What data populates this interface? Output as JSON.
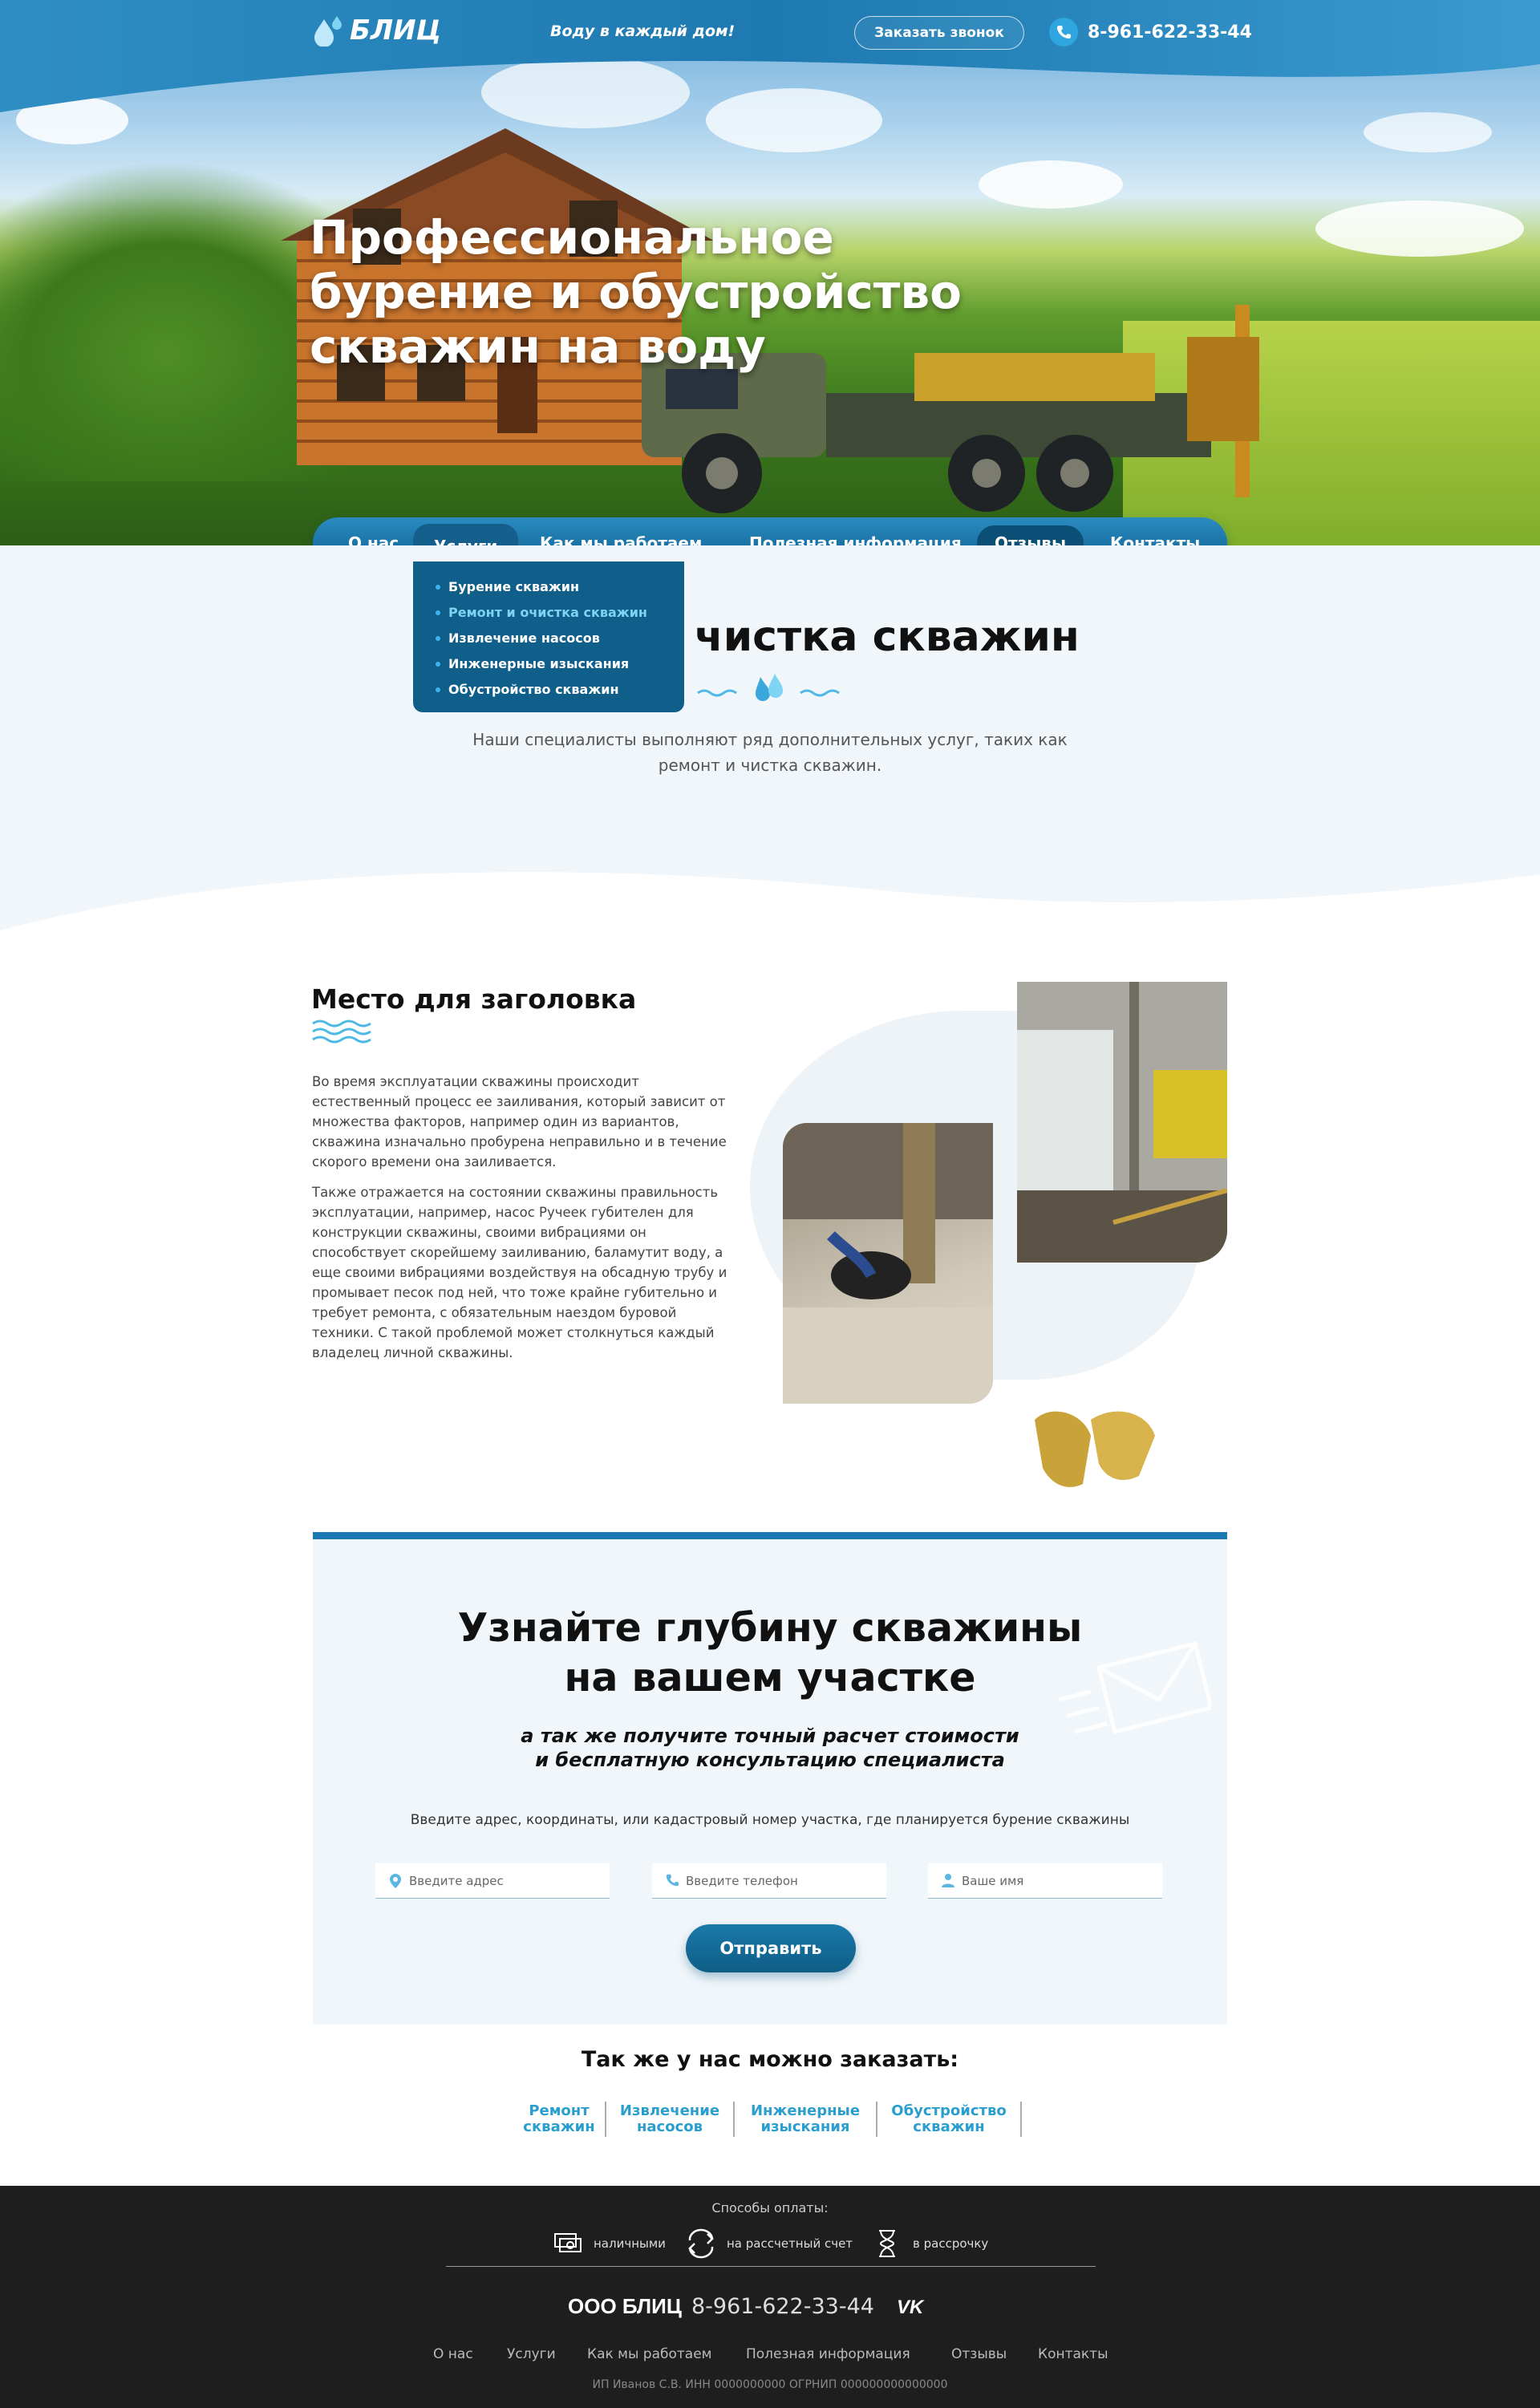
{
  "header": {
    "logo": "БЛИЦ",
    "tagline": "Воду в каждый дом!",
    "call_button": "Заказать звонок",
    "phone": "8-961-622-33-44"
  },
  "hero": {
    "title": "Профессиональное бурение и обустройство скважин на воду"
  },
  "nav": {
    "items": [
      "О нас",
      "Услуги",
      "Как мы работаем",
      "Полезная информация",
      "Отзывы",
      "Контакты"
    ],
    "active": "Услуги",
    "dropdown": [
      "Бурение скважин",
      "Ремонт и очистка скважин",
      "Извлечение насосов",
      "Инженерные изыскания",
      "Обустройство скважин"
    ],
    "dropdown_highlighted": "Ремонт и очистка скважин"
  },
  "section_intro": {
    "title": "чистка скважин",
    "description": "Наши специалисты выполняют ряд дополнительных услуг, таких как ремонт и чистка скважин."
  },
  "article": {
    "title": "Место для заголовка",
    "paragraph1": "Во время эксплуатации скважины происходит естественный процесс ее заиливания, который зависит от множества факторов, например один из вариантов, скважина изначально пробурена неправильно и в течение скорого времени она заиливается.",
    "paragraph2": "Также отражается на состоянии скважины правильность эксплуатации, например, насос Ручеек губителен для конструкции скважины, своими вибрациями он способствует скорейшему заиливанию, баламутит воду, а еще своими вибрациями воздействуя на обсадную трубу и промывает песок под ней, что тоже крайне губительно и требует ремонта, с обязательным наездом буровой техники. С такой проблемой может столкнуться каждый владелец личной скважины."
  },
  "form": {
    "title_line1": "Узнайте глубину скважины",
    "title_line2": "на вашем участке",
    "sub_line1": "а так же получите точный расчет стоимости",
    "sub_line2": "и бесплатную консультацию специалиста",
    "hint": "Введите адрес, координаты, или кадастровый номер  участка, где планируется бурение скважины",
    "address_placeholder": "Введите адрес",
    "phone_placeholder": "Введите телефон",
    "name_placeholder": "Ваше имя",
    "submit": "Отправить"
  },
  "also": {
    "title": "Так же у нас можно заказать:",
    "items": [
      {
        "line1": "Ремонт",
        "line2": "скважин"
      },
      {
        "line1": "Извлечение",
        "line2": "насосов"
      },
      {
        "line1": "Инженерные",
        "line2": "изыскания"
      },
      {
        "line1": "Обустройство",
        "line2": "скважин"
      }
    ]
  },
  "footer": {
    "payment_title": "Способы оплаты:",
    "payments": [
      "наличными",
      "на рассчетный счет",
      "в рассрочку"
    ],
    "company": "ООО БЛИЦ",
    "phone": "8-961-622-33-44",
    "social": "VK",
    "nav": [
      "О нас",
      "Услуги",
      "Как мы работаем",
      "Полезная информация",
      "Отзывы",
      "Контакты"
    ],
    "legal": "ИП Иванов С.В. ИНН 0000000000 ОГРНИП 000000000000000"
  },
  "colors": {
    "accent": "#1d78b2",
    "accent_light": "#2fa6e0",
    "footer_bg": "#1e1e1e"
  }
}
